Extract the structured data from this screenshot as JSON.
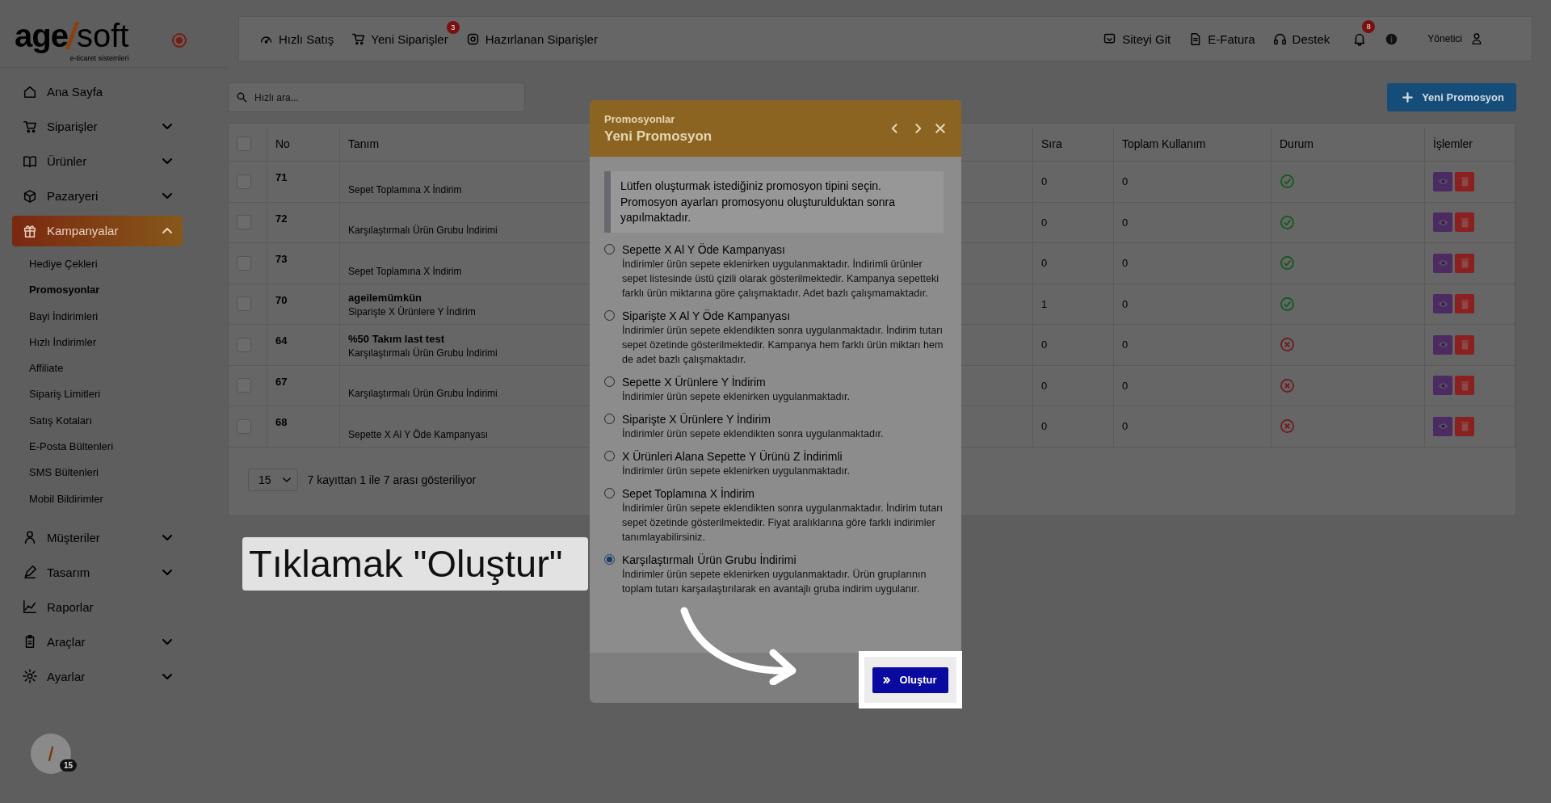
{
  "logo": {
    "main": "age",
    "accent": "soft",
    "tagline": "e-ticaret sistemleri"
  },
  "sidebar": {
    "items": [
      {
        "label": "Ana Sayfa",
        "selected": false
      },
      {
        "label": "Siparişler",
        "selected": false,
        "expanded": false
      },
      {
        "label": "Ürünler",
        "selected": false,
        "expanded": false
      },
      {
        "label": "Pazaryeri",
        "selected": false,
        "expanded": false
      },
      {
        "label": "Kampanyalar",
        "selected": true,
        "expanded": true,
        "children": [
          {
            "label": "Hediye Çekleri",
            "selected": false
          },
          {
            "label": "Promosyonlar",
            "selected": true
          },
          {
            "label": "Bayi İndirimleri",
            "selected": false
          },
          {
            "label": "Hızlı İndirimler",
            "selected": false
          },
          {
            "label": "Affiliate",
            "selected": false
          },
          {
            "label": "Sipariş Limitleri",
            "selected": false
          },
          {
            "label": "Satış Kotaları",
            "selected": false
          },
          {
            "label": "E-Posta Bültenleri",
            "selected": false
          },
          {
            "label": "SMS Bültenleri",
            "selected": false
          },
          {
            "label": "Mobil Bildirimler",
            "selected": false
          }
        ]
      },
      {
        "label": "Müşteriler",
        "selected": false,
        "expanded": false
      },
      {
        "label": "Tasarım",
        "selected": false,
        "expanded": false
      },
      {
        "label": "Raporlar",
        "selected": false
      },
      {
        "label": "Araçlar",
        "selected": false,
        "expanded": false
      },
      {
        "label": "Ayarlar",
        "selected": false,
        "expanded": false
      }
    ],
    "avatar_badge": "15"
  },
  "topbar": {
    "left": [
      {
        "label": "Hızlı Satış"
      },
      {
        "label": "Yeni Siparişler",
        "badge": "3"
      },
      {
        "label": "Hazırlanan Siparişler"
      }
    ],
    "right": [
      {
        "label": "Siteyi Git"
      },
      {
        "label": "E-Fatura"
      },
      {
        "label": "Destek"
      }
    ],
    "notifications_badge": "8",
    "user": "Yönetici"
  },
  "search": {
    "placeholder": "Hızlı ara..."
  },
  "new_button": "Yeni Promosyon",
  "table": {
    "select_all_checked": false,
    "columns": [
      "No",
      "Tanım",
      "Sıra",
      "Toplam Kullanım",
      "Durum",
      "İşlemler"
    ],
    "rows": [
      {
        "checked": false,
        "no": "71",
        "type": "Sepet Toplamına X İndirim",
        "sira": "0",
        "usage": "0",
        "active": true
      },
      {
        "checked": false,
        "no": "72",
        "type": "Karşılaştırmalı Ürün Grubu İndirimi",
        "sira": "0",
        "usage": "0",
        "active": true
      },
      {
        "checked": false,
        "no": "73",
        "type": "Sepet Toplamına X İndirim",
        "sira": "0",
        "usage": "0",
        "active": true
      },
      {
        "checked": false,
        "no": "70",
        "name": "ageilemümkün",
        "type": "Siparişte X Ürünlere Y İndirim",
        "sira": "1",
        "usage": "0",
        "active": true
      },
      {
        "checked": false,
        "no": "64",
        "name": "%50 Takım last test",
        "type": "Karşılaştırmalı Ürün Grubu İndirimi",
        "sira": "0",
        "usage": "0",
        "active": false
      },
      {
        "checked": false,
        "no": "67",
        "type": "Karşılaştırmalı Ürün Grubu İndirimi",
        "sira": "0",
        "usage": "0",
        "active": false
      },
      {
        "checked": false,
        "no": "68",
        "type": "Sepette X Al Y Öde Kampanyası",
        "sira": "0",
        "usage": "0",
        "active": false
      }
    ]
  },
  "pager": {
    "page_size": "15",
    "info": "7 kayıttan 1 ile 7 arası gösteriliyor"
  },
  "modal": {
    "breadcrumb": "Promosyonlar",
    "title": "Yeni Promosyon",
    "info": "Lütfen oluşturmak istediğiniz promosyon tipini seçin. Promosyon ayarları promosyonu oluşturulduktan sonra yapılmaktadır.",
    "options": [
      {
        "title": "Sepette X Al Y Öde Kampanyası",
        "description": "İndirimler ürün sepete eklenirken uygulanmaktadır. İndirimli ürünler sepet listesinde üstü çizili olarak gösterilmektedir. Kampanya sepetteki farklı ürün miktarına göre çalışmaktadır. Adet bazlı çalışmamaktadır.",
        "selected": false
      },
      {
        "title": "Siparişte X Al Y Öde Kampanyası",
        "description": "İndirimler ürün sepete eklendikten sonra uygulanmaktadır. İndirim tutarı sepet özetinde gösterilmektedir. Kampanya hem farklı ürün miktarı hem de adet bazlı çalışmaktadır.",
        "selected": false
      },
      {
        "title": "Sepette X Ürünlere Y İndirim",
        "description": "İndirimler ürün sepete eklenirken uygulanmaktadır.",
        "selected": false
      },
      {
        "title": "Siparişte X Ürünlere Y İndirim",
        "description": "İndirimler ürün sepete eklendikten sonra uygulanmaktadır.",
        "selected": false
      },
      {
        "title": "X Ürünleri Alana Sepette Y Ürünü Z İndirimli",
        "description": "İndirimler ürün sepete eklenirken uygulanmaktadır.",
        "selected": false
      },
      {
        "title": "Sepet Toplamına X İndirim",
        "description": "İndirimler ürün sepete eklendikten sonra uygulanmaktadır. İndirim tutarı sepet özetinde gösterilmektedir. Fiyat aralıklarına göre farklı indirimler tanımlayabilirsiniz.",
        "selected": false
      },
      {
        "title": "Karşılaştırmalı Ürün Grubu İndirimi",
        "description": "İndirimler ürün sepete eklenirken uygulanmaktadır. Ürün gruplarının toplam tutarı karşaılaştırılarak en avantajlı gruba indirim uygulanır.",
        "selected": true
      }
    ],
    "submit": "Oluştur"
  },
  "tutorial": {
    "callout": "Tıklamak \"Oluştur\""
  }
}
